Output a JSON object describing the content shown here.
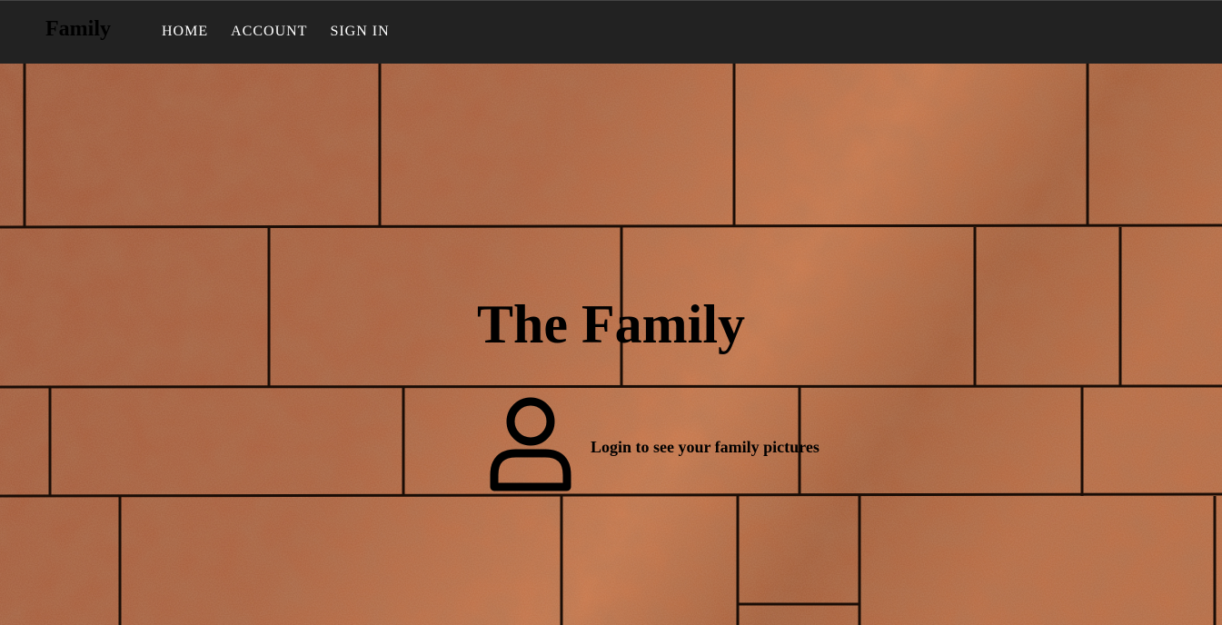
{
  "navbar": {
    "brand": "Family",
    "links": [
      {
        "label": "HOME"
      },
      {
        "label": "ACCOUNT"
      },
      {
        "label": "SIGN IN"
      }
    ],
    "background": "#222222"
  },
  "hero": {
    "title": "The Family",
    "login_text": "Login to see your family pictures",
    "icon": "user-icon",
    "background_image": "stone-brick-wall",
    "brick_color": "#b0633a",
    "mortar_color": "#1a0d06"
  }
}
